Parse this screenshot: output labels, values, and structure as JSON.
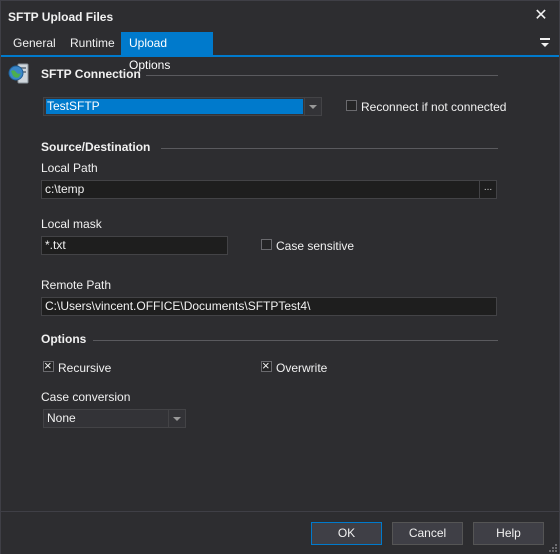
{
  "window": {
    "title": "SFTP Upload Files"
  },
  "tabs": [
    {
      "label": "General",
      "active": false
    },
    {
      "label": "Runtime",
      "active": false
    },
    {
      "label": "Upload Options",
      "active": true
    }
  ],
  "sftp_connection": {
    "section_title": "SFTP Connection",
    "selected": "TestSFTP",
    "reconnect_label": "Reconnect if not connected",
    "reconnect_checked": false
  },
  "source_destination": {
    "section_title": "Source/Destination",
    "local_path_label": "Local Path",
    "local_path_value": "c:\\temp",
    "browse_label": "...",
    "local_mask_label": "Local mask",
    "local_mask_value": "*.txt",
    "case_sensitive_label": "Case sensitive",
    "case_sensitive_checked": false,
    "remote_path_label": "Remote Path",
    "remote_path_value": "C:\\Users\\vincent.OFFICE\\Documents\\SFTPTest4\\"
  },
  "options": {
    "section_title": "Options",
    "recursive_label": "Recursive",
    "recursive_checked": true,
    "overwrite_label": "Overwrite",
    "overwrite_checked": true,
    "case_conversion_label": "Case conversion",
    "case_conversion_value": "None"
  },
  "buttons": {
    "ok": "OK",
    "cancel": "Cancel",
    "help": "Help"
  },
  "icons": {
    "close": "close-icon",
    "tab_menu": "menu-dropdown-icon",
    "connection": "server-globe-icon"
  },
  "colors": {
    "accent": "#007acc",
    "background": "#2d2d30",
    "input_background": "#1e1e1e"
  }
}
